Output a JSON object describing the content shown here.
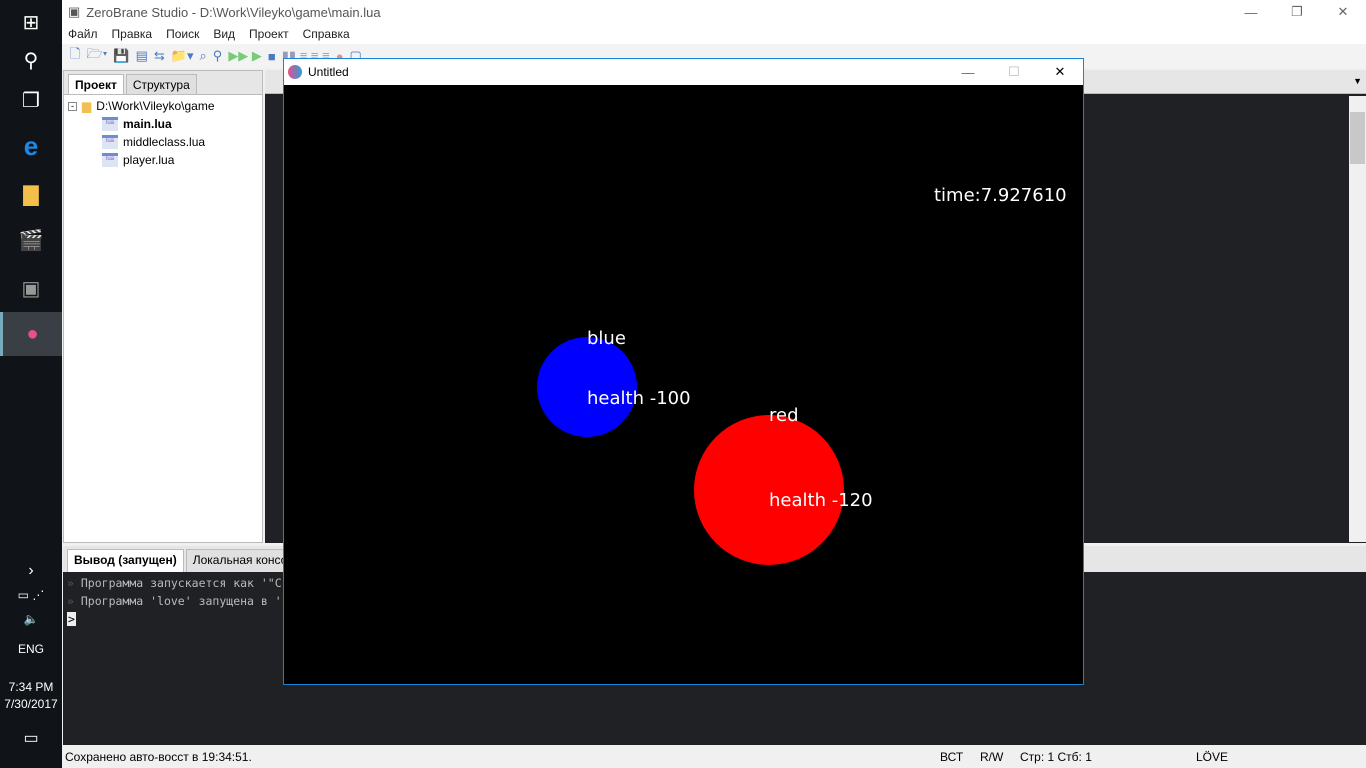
{
  "taskbar": {
    "language": "ENG",
    "time": "7:34 PM",
    "date": "7/30/2017"
  },
  "ide": {
    "title": "ZeroBrane Studio - D:\\Work\\Vileyko\\game\\main.lua",
    "menu": [
      "Файл",
      "Правка",
      "Поиск",
      "Вид",
      "Проект",
      "Справка"
    ],
    "project_tabs": [
      "Проект",
      "Структура"
    ],
    "tree": {
      "root": "D:\\Work\\Vileyko\\game",
      "files": [
        "main.lua",
        "middleclass.lua",
        "player.lua"
      ]
    },
    "output_tabs": [
      "Вывод (запущен)",
      "Локальная консоль"
    ],
    "output_lines": [
      "Программа запускается как '\"C",
      "Программа 'love' запущена в '"
    ],
    "prompt": ">",
    "status": {
      "message": "Сохранено авто-восст в 19:34:51.",
      "mode": "ВСТ",
      "rw": "R/W",
      "position": "Стр: 1 Стб: 1",
      "interpreter": "LÖVE"
    }
  },
  "love": {
    "title": "Untitled",
    "time_label": "time:7.927610",
    "players": [
      {
        "name": "blue",
        "health": "health -100",
        "color": "#0000ff"
      },
      {
        "name": "red",
        "health": "health -120",
        "color": "#ff0000"
      }
    ]
  }
}
